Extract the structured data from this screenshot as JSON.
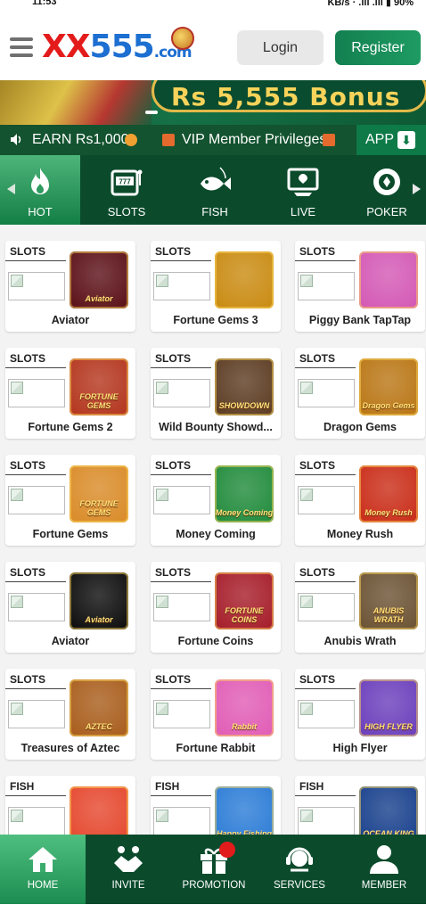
{
  "statusbar": {
    "time": "11:53",
    "right": "KB/s  ·  .ıll .ıll  ▮ 90%"
  },
  "header": {
    "logo_xx": "XX",
    "logo_num": "555",
    "logo_com": ".com",
    "login_label": "Login",
    "register_label": "Register"
  },
  "banner": {
    "text": "Rs 5,555 Bonus"
  },
  "marquee": {
    "earn": "EARN Rs1,000",
    "vip": "VIP Member Privileges",
    "app_label": "APP"
  },
  "categories": [
    {
      "label": "HOT",
      "icon": "flame-icon"
    },
    {
      "label": "SLOTS",
      "icon": "slot-machine-icon"
    },
    {
      "label": "FISH",
      "icon": "fish-icon"
    },
    {
      "label": "LIVE",
      "icon": "live-cards-icon"
    },
    {
      "label": "POKER",
      "icon": "poker-chip-icon"
    }
  ],
  "games": [
    {
      "category": "SLOTS",
      "name": "Aviator",
      "thumb_color": "#5a0f16",
      "thumb_text": "Aviator"
    },
    {
      "category": "SLOTS",
      "name": "Fortune Gems 3",
      "thumb_color": "#c98a10",
      "thumb_text": ""
    },
    {
      "category": "SLOTS",
      "name": "Piggy Bank TapTap",
      "thumb_color": "#d357b4",
      "thumb_text": ""
    },
    {
      "category": "SLOTS",
      "name": "Fortune Gems 2",
      "thumb_color": "#b3341c",
      "thumb_text": "FORTUNE GEMS"
    },
    {
      "category": "SLOTS",
      "name": "Wild Bounty Showd...",
      "thumb_color": "#5b3a20",
      "thumb_text": "SHOWDOWN"
    },
    {
      "category": "SLOTS",
      "name": "Dragon Gems",
      "thumb_color": "#b97513",
      "thumb_text": "Dragon Gems"
    },
    {
      "category": "SLOTS",
      "name": "Fortune Gems",
      "thumb_color": "#d98a26",
      "thumb_text": "FORTUNE GEMS"
    },
    {
      "category": "SLOTS",
      "name": "Money Coming",
      "thumb_color": "#1f8a3a",
      "thumb_text": "Money Coming"
    },
    {
      "category": "SLOTS",
      "name": "Money Rush",
      "thumb_color": "#c92b16",
      "thumb_text": "Money Rush"
    },
    {
      "category": "SLOTS",
      "name": "Aviator",
      "thumb_color": "#0b0b0b",
      "thumb_text": "Aviator"
    },
    {
      "category": "SLOTS",
      "name": "Fortune Coins",
      "thumb_color": "#a51b28",
      "thumb_text": "FORTUNE COINS"
    },
    {
      "category": "SLOTS",
      "name": "Anubis Wrath",
      "thumb_color": "#6a5132",
      "thumb_text": "ANUBIS WRATH"
    },
    {
      "category": "SLOTS",
      "name": "Treasures of Aztec",
      "thumb_color": "#a85c1a",
      "thumb_text": "AZTEC"
    },
    {
      "category": "SLOTS",
      "name": "Fortune Rabbit",
      "thumb_color": "#e05bb5",
      "thumb_text": "Rabbit"
    },
    {
      "category": "SLOTS",
      "name": "High Flyer",
      "thumb_color": "#6a3dbb",
      "thumb_text": "HIGH FLYER"
    },
    {
      "category": "FISH",
      "name": "",
      "thumb_color": "#e5462c",
      "thumb_text": ""
    },
    {
      "category": "FISH",
      "name": "",
      "thumb_color": "#2a7bd6",
      "thumb_text": "Happy Fishing"
    },
    {
      "category": "FISH",
      "name": "",
      "thumb_color": "#173f8c",
      "thumb_text": "OCEAN KING"
    }
  ],
  "nav": [
    {
      "label": "HOME",
      "icon": "home-icon"
    },
    {
      "label": "INVITE",
      "icon": "handshake-icon"
    },
    {
      "label": "PROMOTION",
      "icon": "gift-icon"
    },
    {
      "label": "SERVICES",
      "icon": "headset-icon"
    },
    {
      "label": "MEMBER",
      "icon": "user-icon"
    }
  ],
  "colors": {
    "brand_green": "#0b4b2c",
    "accent_green": "#138051",
    "logo_red": "#e41b1b",
    "logo_blue": "#1d6fd1",
    "promo_badge": "#e21b1b"
  }
}
